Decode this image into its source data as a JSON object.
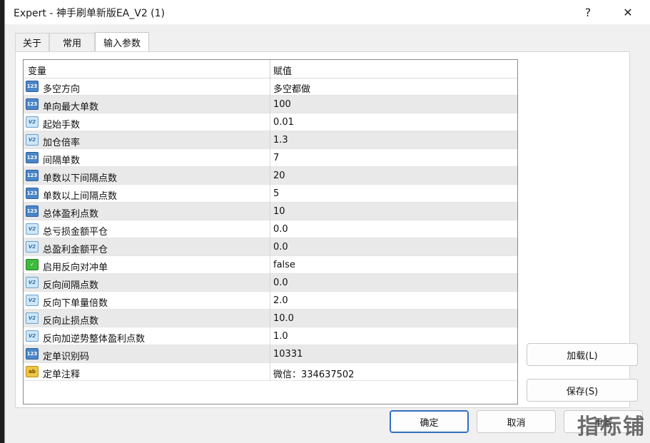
{
  "window": {
    "title": "Expert - 神手刷单新版EA_V2 (1)",
    "help_label": "?",
    "close_label": "✕"
  },
  "tabs": [
    {
      "label": "关于"
    },
    {
      "label": "常用"
    },
    {
      "label": "输入参数",
      "active": true
    }
  ],
  "grid": {
    "col_variable": "变量",
    "col_value": "赋值",
    "rows": [
      {
        "icon": "int",
        "icon_text": "123",
        "name": "多空方向",
        "value": "多空都做"
      },
      {
        "icon": "int",
        "icon_text": "123",
        "name": "单向最大单数",
        "value": "100"
      },
      {
        "icon": "dbl",
        "icon_text": "V2",
        "name": "起始手数",
        "value": "0.01"
      },
      {
        "icon": "dbl",
        "icon_text": "V2",
        "name": "加仓倍率",
        "value": "1.3"
      },
      {
        "icon": "int",
        "icon_text": "123",
        "name": "间隔单数",
        "value": "7"
      },
      {
        "icon": "int",
        "icon_text": "123",
        "name": "单数以下间隔点数",
        "value": "20"
      },
      {
        "icon": "int",
        "icon_text": "123",
        "name": "单数以上间隔点数",
        "value": "5"
      },
      {
        "icon": "int",
        "icon_text": "123",
        "name": "总体盈利点数",
        "value": "10"
      },
      {
        "icon": "dbl",
        "icon_text": "V2",
        "name": "总亏损金额平仓",
        "value": "0.0"
      },
      {
        "icon": "dbl",
        "icon_text": "V2",
        "name": "总盈利金额平仓",
        "value": "0.0"
      },
      {
        "icon": "bool",
        "icon_text": "✓",
        "name": "启用反向对冲单",
        "value": "false"
      },
      {
        "icon": "dbl",
        "icon_text": "V2",
        "name": "反向间隔点数",
        "value": "0.0"
      },
      {
        "icon": "dbl",
        "icon_text": "V2",
        "name": "反向下单量倍数",
        "value": "2.0"
      },
      {
        "icon": "dbl",
        "icon_text": "V2",
        "name": "反向止损点数",
        "value": "10.0"
      },
      {
        "icon": "dbl",
        "icon_text": "V2",
        "name": "反向加逆势整体盈利点数",
        "value": "1.0"
      },
      {
        "icon": "int",
        "icon_text": "123",
        "name": "定单识别码",
        "value": "10331"
      },
      {
        "icon": "str",
        "icon_text": "ab",
        "name": "定单注释",
        "value": "微信：334637502"
      }
    ]
  },
  "buttons": {
    "load": "加载(L)",
    "save": "保存(S)",
    "ok": "确定",
    "cancel": "取消",
    "reset": "重置"
  },
  "watermark": "指标铺"
}
